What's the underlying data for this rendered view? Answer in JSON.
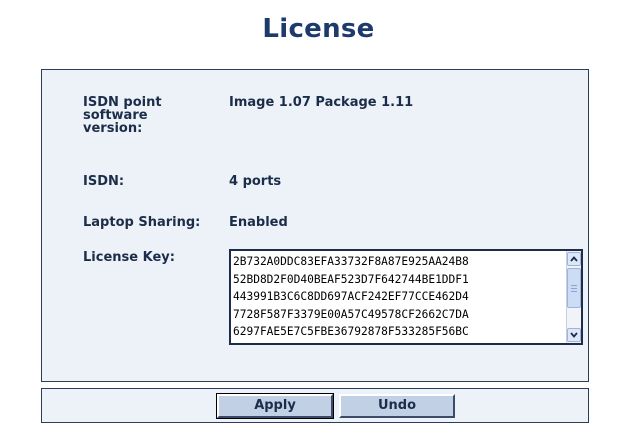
{
  "page": {
    "title": "License"
  },
  "fields": {
    "isdn_version": {
      "label": "ISDN point software version:",
      "value": "Image 1.07 Package 1.11"
    },
    "isdn": {
      "label": "ISDN:",
      "value": "4 ports"
    },
    "laptop_sharing": {
      "label": "Laptop Sharing:",
      "value": "Enabled"
    },
    "license_key": {
      "label": "License Key:",
      "value": "2B732A0DDC83EFA33732F8A87E925AA24B8\n52BD8D2F0D40BEAF523D7F642744BE1DDF1\n443991B3C6C8DD697ACF242EF77CCE462D4\n7728F587F3379E00A57C49578CF2662C7DA\n6297FAE5E7C5FBE36792878F533285F56BC"
    }
  },
  "buttons": {
    "apply_label": "Apply",
    "undo_label": "Undo"
  },
  "icons": {
    "scroll_up": "chevron-up-icon",
    "scroll_down": "chevron-down-icon"
  },
  "colors": {
    "title": "#1c3a6b",
    "panel_bg": "#ecf2f8",
    "panel_border": "#2a3d5c",
    "button_bg": "#c2d0e6"
  }
}
